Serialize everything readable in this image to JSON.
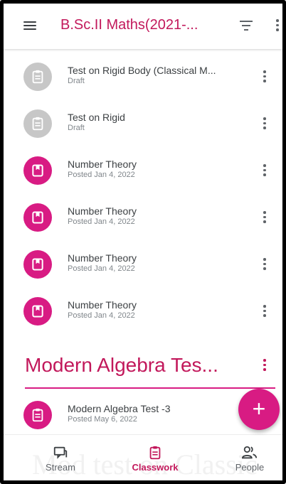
{
  "header": {
    "title": "B.Sc.II Maths(2021-..."
  },
  "items": [
    {
      "title": "Test on Rigid Body (Classical M...",
      "subtitle": "Draft",
      "state": "draft"
    },
    {
      "title": "Test on Rigid",
      "subtitle": "Draft",
      "state": "draft"
    },
    {
      "title": "Number Theory",
      "subtitle": "Posted Jan 4, 2022",
      "state": "posted"
    },
    {
      "title": "Number Theory",
      "subtitle": "Posted Jan 4, 2022",
      "state": "posted"
    },
    {
      "title": "Number Theory",
      "subtitle": "Posted Jan 4, 2022",
      "state": "posted"
    },
    {
      "title": "Number Theory",
      "subtitle": "Posted Jan 4, 2022",
      "state": "posted"
    }
  ],
  "topic": {
    "title": "Modern Algebra Tes...",
    "items": [
      {
        "title": "Modern Algebra Test -3",
        "subtitle": "Posted May 6, 2022",
        "state": "posted"
      }
    ]
  },
  "fab": {
    "label": "+"
  },
  "nav": {
    "tabs": [
      {
        "label": "Stream",
        "icon": "stream-icon",
        "active": false
      },
      {
        "label": "Classwork",
        "icon": "classwork-icon",
        "active": true
      },
      {
        "label": "People",
        "icon": "people-icon",
        "active": false
      }
    ],
    "background_text": "Mod test on Classic"
  },
  "colors": {
    "accent": "#c2185b",
    "fab": "#d81b83",
    "draft_avatar": "#c7c7c7"
  }
}
